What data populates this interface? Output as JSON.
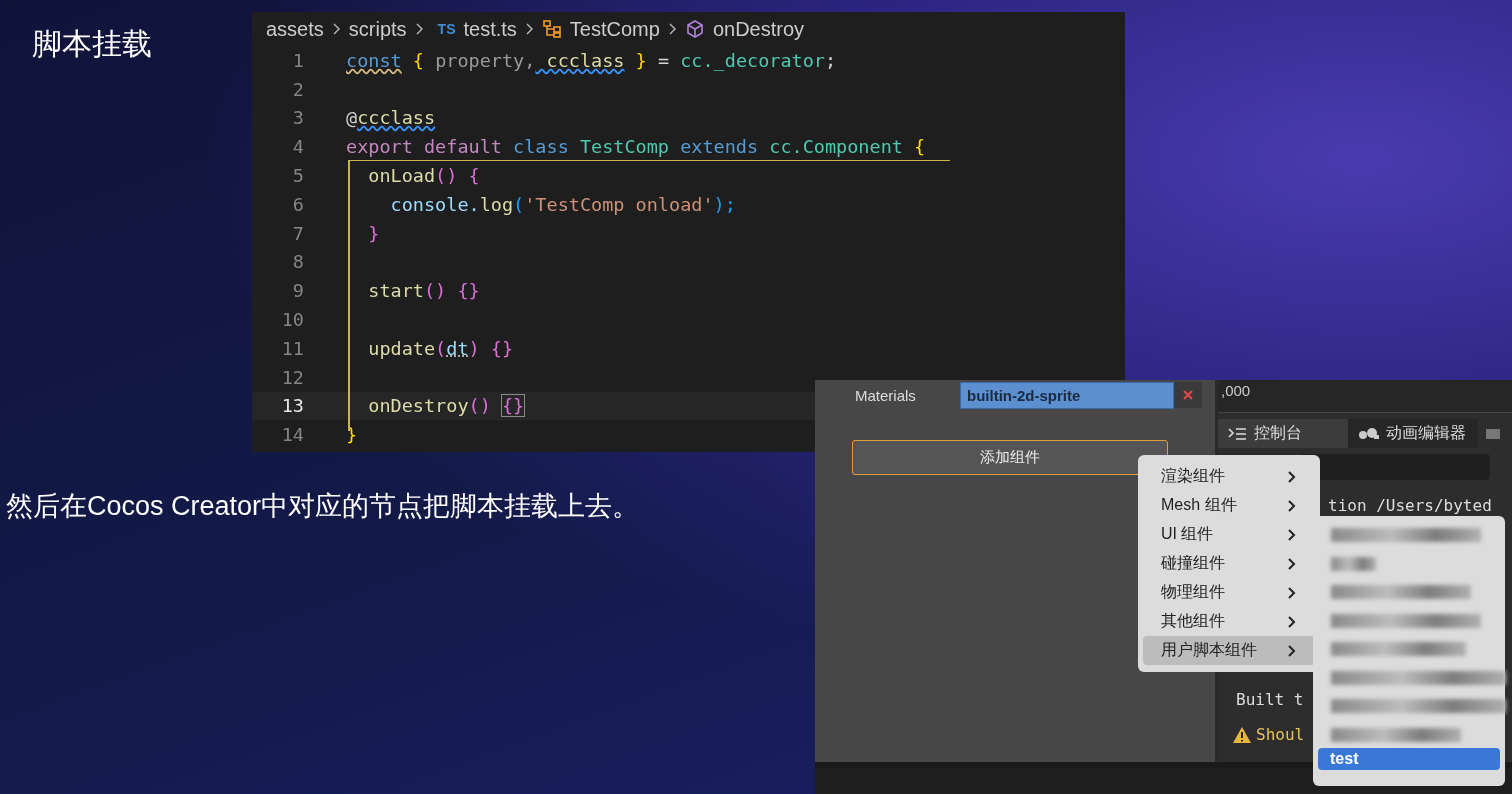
{
  "slide_title": "脚本挂载",
  "editor": {
    "breadcrumb": [
      {
        "text": "assets",
        "kind": "plain"
      },
      {
        "text": "scripts",
        "kind": "plain"
      },
      {
        "text": "test.ts",
        "kind": "ts",
        "badge": "TS"
      },
      {
        "text": "TestComp",
        "kind": "class"
      },
      {
        "text": "onDestroy",
        "kind": "method"
      }
    ],
    "lines": [
      {
        "number": "1",
        "current": false,
        "tokens": [
          {
            "t": "const",
            "kind": "keyword",
            "warning_squiggle": true
          },
          {
            "t": " { ",
            "kind": "bracket1"
          },
          {
            "t": "property,",
            "kind": "unused"
          },
          {
            "t": " ccclass",
            "kind": "function",
            "info_squiggle": true
          },
          {
            "t": " } ",
            "kind": "bracket1"
          },
          {
            "t": "= ",
            "kind": "plain"
          },
          {
            "t": "cc._decorator",
            "kind": "type"
          },
          {
            "t": ";",
            "kind": "plain"
          }
        ]
      },
      {
        "number": "2",
        "current": false
      },
      {
        "number": "3",
        "current": false,
        "tokens": [
          {
            "t": "@",
            "kind": "plain"
          },
          {
            "t": "ccclass",
            "kind": "function",
            "info_squiggle": true
          }
        ]
      },
      {
        "number": "4",
        "current": false,
        "tokens": [
          {
            "t": "export default ",
            "kind": "control"
          },
          {
            "t": "class ",
            "kind": "keyword"
          },
          {
            "t": "TestComp ",
            "kind": "type"
          },
          {
            "t": "extends ",
            "kind": "keyword"
          },
          {
            "t": "cc.Component ",
            "kind": "type"
          },
          {
            "t": "{",
            "kind": "bracket1"
          }
        ]
      },
      {
        "number": "5",
        "current": false,
        "tokens": [
          {
            "t": "  onLoad",
            "kind": "function"
          },
          {
            "t": "() {",
            "kind": "bracket2"
          }
        ]
      },
      {
        "number": "6",
        "current": false,
        "tokens": [
          {
            "t": "    console.",
            "kind": "variable"
          },
          {
            "t": "log",
            "kind": "function"
          },
          {
            "t": "(",
            "kind": "bracket3"
          },
          {
            "t": "'TestComp onload'",
            "kind": "string"
          },
          {
            "t": ");",
            "kind": "bracket3"
          }
        ]
      },
      {
        "number": "7",
        "current": false,
        "tokens": [
          {
            "t": "  }",
            "kind": "bracket2"
          }
        ]
      },
      {
        "number": "8",
        "current": false
      },
      {
        "number": "9",
        "current": false,
        "tokens": [
          {
            "t": "  start",
            "kind": "function"
          },
          {
            "t": "() {}",
            "kind": "bracket2"
          }
        ]
      },
      {
        "number": "10",
        "current": false
      },
      {
        "number": "11",
        "current": false,
        "tokens": [
          {
            "t": "  update",
            "kind": "function"
          },
          {
            "t": "(",
            "kind": "bracket2"
          },
          {
            "t": "dt",
            "kind": "variable",
            "hint_dots": true
          },
          {
            "t": ") {}",
            "kind": "bracket2"
          }
        ]
      },
      {
        "number": "12",
        "current": false
      },
      {
        "number": "13",
        "current": true,
        "tokens": [
          {
            "t": "  onDestroy",
            "kind": "function"
          },
          {
            "t": "() ",
            "kind": "bracket2"
          },
          {
            "t": "{}",
            "kind": "bracket2",
            "bracket_match": true
          }
        ]
      },
      {
        "number": "14",
        "current": false,
        "tokens": [
          {
            "t": "}",
            "kind": "bracket1"
          }
        ]
      }
    ]
  },
  "caption": "然后在Cocos Creator中对应的节点把脚本挂载上去。",
  "inspector": {
    "materials_label": "Materials",
    "material_value": "builtin-2d-sprite",
    "add_button": "添加组件"
  },
  "console": {
    "field_value": ",000",
    "tabs": [
      {
        "label": "控制台",
        "selected": true,
        "kind": "console"
      },
      {
        "label": "动画编辑器",
        "selected": false,
        "kind": "animation"
      }
    ],
    "lines": [
      {
        "text": "tion /Users/byted",
        "kind": "log"
      },
      {
        "text": "Built t",
        "kind": "log"
      },
      {
        "text": "Shoul",
        "kind": "warning"
      }
    ]
  },
  "menu": {
    "items": [
      {
        "label": "渲染组件",
        "selected": false
      },
      {
        "label": "Mesh 组件",
        "selected": false
      },
      {
        "label": "UI 组件",
        "selected": false
      },
      {
        "label": "碰撞组件",
        "selected": false
      },
      {
        "label": "物理组件",
        "selected": false
      },
      {
        "label": "其他组件",
        "selected": false
      },
      {
        "label": "用户脚本组件",
        "selected": true
      }
    ]
  },
  "submenu": {
    "items": [
      {
        "label": "test",
        "selected": true
      }
    ]
  }
}
